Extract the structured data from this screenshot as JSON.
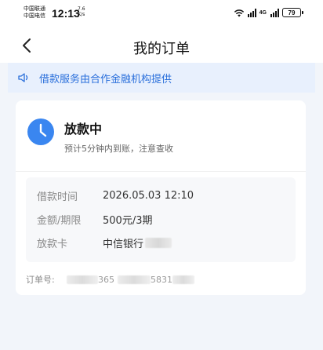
{
  "status_bar": {
    "carrier_1": "中国联通",
    "carrier_2": "中国电信",
    "time": "12:13",
    "net_speed_value": "7.6",
    "net_speed_unit": "K/s",
    "signal_label": "4G",
    "battery": "79"
  },
  "nav": {
    "title": "我的订单"
  },
  "notice": {
    "text": "借款服务由合作金融机构提供"
  },
  "order": {
    "status_title": "放款中",
    "status_subtitle": "预计5分钟内到账，注意查收",
    "details": [
      {
        "label": "借款时间",
        "value": "2026.05.03 12:10"
      },
      {
        "label": "金额/期限",
        "value": "500元/3期"
      },
      {
        "label": "放款卡",
        "value": "中信银行"
      }
    ],
    "order_no_label": "订单号:",
    "order_no_part_1": "365",
    "order_no_part_2": "5831"
  },
  "colors": {
    "accent": "#2a6fdb",
    "status_icon": "#3a86f0",
    "notice_bg": "#e8f0fd",
    "page_bg": "#f2f5fa"
  }
}
